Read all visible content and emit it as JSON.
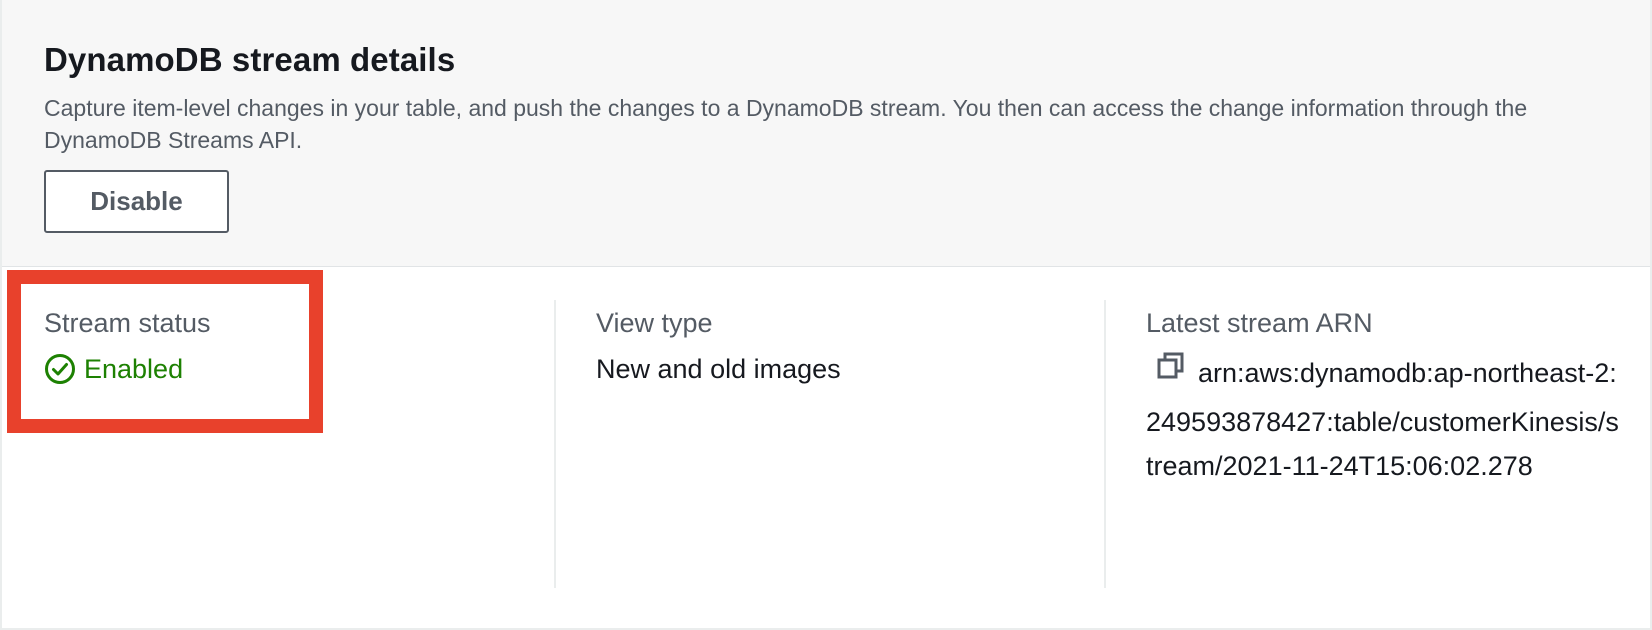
{
  "section": {
    "title": "DynamoDB stream details",
    "description": "Capture item-level changes in your table, and push the changes to a DynamoDB stream. You then can access the change information through the DynamoDB Streams API.",
    "disable_label": "Disable"
  },
  "details": {
    "stream_status_label": "Stream status",
    "stream_status_value": "Enabled",
    "view_type_label": "View type",
    "view_type_value": "New and old images",
    "arn_label": "Latest stream ARN",
    "arn_value": "arn:aws:dynamodb:ap-northeast-2:249593878427:table/customerKinesis/stream/2021-11-24T15:06:02.278"
  },
  "colors": {
    "enabled": "#1d8102",
    "highlight": "#e8412c"
  },
  "icons": {
    "status": "check-circle-icon",
    "copy": "copy-icon"
  }
}
